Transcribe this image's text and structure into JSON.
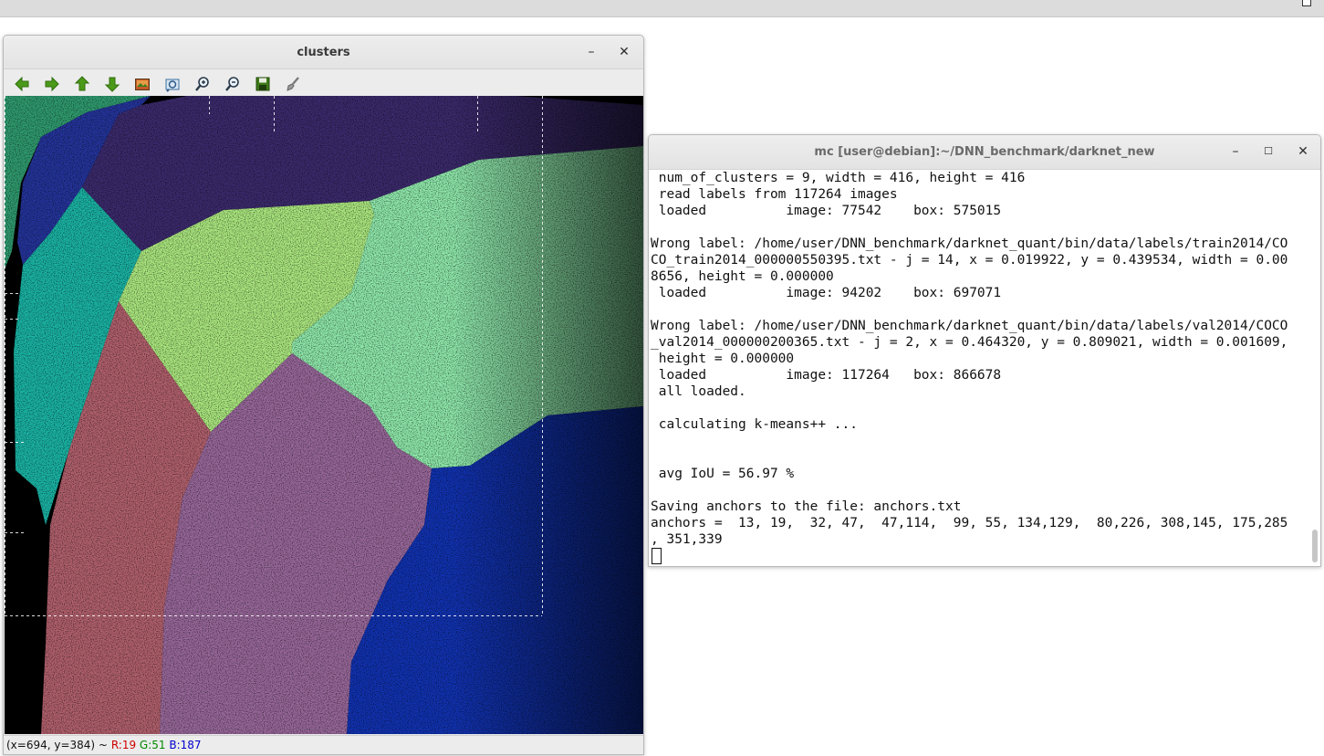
{
  "clusters_window": {
    "title": "clusters",
    "minimize_glyph": "–",
    "close_glyph": "✕",
    "toolbar": [
      {
        "name": "pan-left-icon",
        "kind": "arrow-left"
      },
      {
        "name": "pan-right-icon",
        "kind": "arrow-right"
      },
      {
        "name": "pan-up-icon",
        "kind": "arrow-up"
      },
      {
        "name": "pan-down-icon",
        "kind": "arrow-down"
      },
      {
        "name": "zoom-fit-image-icon",
        "kind": "image"
      },
      {
        "name": "zoom-original-icon",
        "kind": "zoom-frame"
      },
      {
        "name": "zoom-in-icon",
        "kind": "zoom-in"
      },
      {
        "name": "zoom-out-icon",
        "kind": "zoom-out"
      },
      {
        "name": "save-image-icon",
        "kind": "save"
      },
      {
        "name": "properties-brush-icon",
        "kind": "brush"
      }
    ],
    "status": {
      "coords": "(x=694, y=384) ~",
      "r": "R:19",
      "g": "G:51",
      "b": "B:187"
    },
    "plot": {
      "background": "#000000",
      "cluster_colors": [
        "#2f9a6e",
        "#24349a",
        "#3b2a6c",
        "#1ab3a4",
        "#aae67e",
        "#8ee7aa",
        "#b0606c",
        "#976799",
        "#1132b0"
      ]
    }
  },
  "terminal_window": {
    "title": "mc [user@debian]:~/DNN_benchmark/darknet_new",
    "minimize_glyph": "–",
    "maximize_glyph": "☐",
    "close_glyph": "✕",
    "lines": [
      " num_of_clusters = 9, width = 416, height = 416",
      " read labels from 117264 images",
      " loaded          image: 77542    box: 575015",
      "",
      "Wrong label: /home/user/DNN_benchmark/darknet_quant/bin/data/labels/train2014/CO",
      "CO_train2014_000000550395.txt - j = 14, x = 0.019922, y = 0.439534, width = 0.00",
      "8656, height = 0.000000",
      " loaded          image: 94202    box: 697071",
      "",
      "Wrong label: /home/user/DNN_benchmark/darknet_quant/bin/data/labels/val2014/COCO",
      "_val2014_000000200365.txt - j = 2, x = 0.464320, y = 0.809021, width = 0.001609,",
      " height = 0.000000",
      " loaded          image: 117264   box: 866678",
      " all loaded.",
      "",
      " calculating k-means++ ...",
      "",
      "",
      " avg IoU = 56.97 %",
      "",
      "Saving anchors to the file: anchors.txt",
      "anchors =  13, 19,  32, 47,  47,114,  99, 55, 134,129,  80,226, 308,145, 175,285",
      ", 351,339"
    ]
  }
}
